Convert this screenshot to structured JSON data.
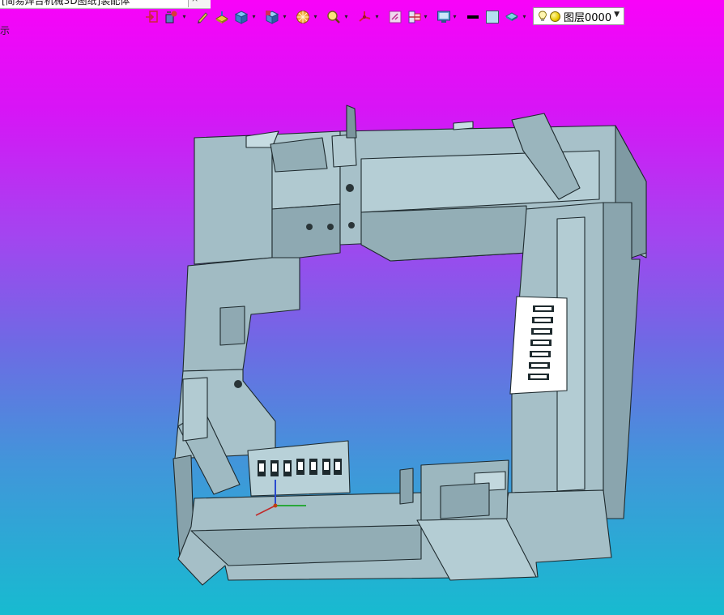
{
  "window": {
    "tab_title": "[简易焊台机械3D图纸]装配体",
    "tab_more": "×"
  },
  "sidebar": {
    "label": "示"
  },
  "toolbar": {
    "buttons": [
      {
        "id": "exit-sketch",
        "icon": "exit-sketch-icon"
      },
      {
        "id": "smart-dimension",
        "icon": "dimension-icon",
        "dropdown": true
      },
      {
        "id": "line-tool",
        "icon": "pencil-icon"
      },
      {
        "id": "feature",
        "icon": "extrude-icon"
      },
      {
        "id": "view-cube",
        "icon": "cube-icon",
        "dropdown": true
      },
      {
        "id": "view-orientation",
        "icon": "orientation-icon",
        "dropdown": true
      },
      {
        "id": "display-style",
        "icon": "display-style-icon",
        "dropdown": true
      },
      {
        "id": "zoom",
        "icon": "zoom-icon",
        "dropdown": true
      },
      {
        "id": "triad",
        "icon": "triad-icon",
        "dropdown": true
      },
      {
        "id": "section-view",
        "icon": "section-icon"
      },
      {
        "id": "hide-show",
        "icon": "hide-show-icon",
        "dropdown": true
      },
      {
        "id": "display-monitor",
        "icon": "monitor-icon",
        "dropdown": true
      },
      {
        "id": "line-color",
        "icon": "line-color-icon"
      },
      {
        "id": "fill-color",
        "icon": "fill-color-icon"
      },
      {
        "id": "appearance",
        "icon": "appearance-icon",
        "dropdown": true
      }
    ],
    "layer": {
      "value": "图层0000",
      "bulb_icon": "lightbulb-icon",
      "status_icon": "layer-dot-icon"
    }
  },
  "colors": {
    "background_top": "#f803f9",
    "background_bottom": "#17bbd0",
    "model_face": "#a6c0c8",
    "model_edge": "#1e2a2e"
  },
  "model": {
    "type": "assembly-3d-view",
    "panel_slots_right": 7,
    "panel_slots_bottom": 6
  }
}
